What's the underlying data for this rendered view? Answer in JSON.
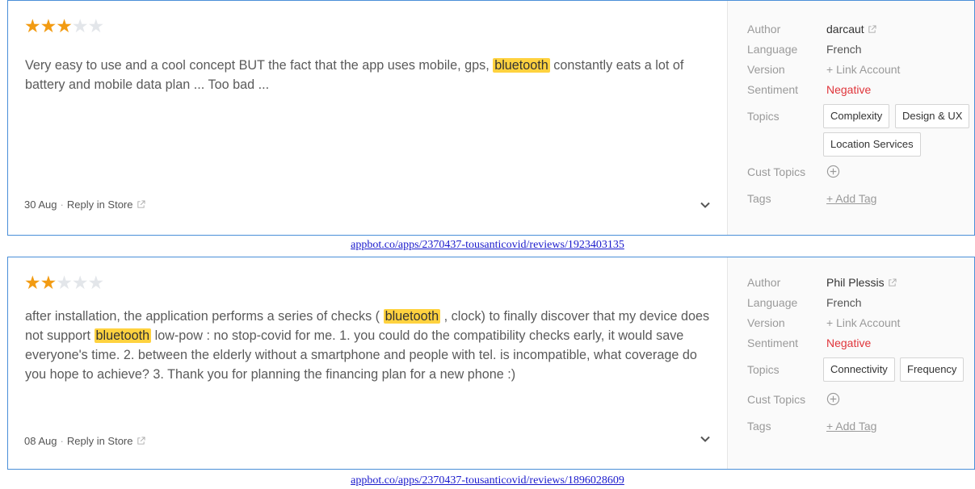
{
  "reviews": [
    {
      "rating": 3,
      "text_parts": [
        "Very easy to use and a cool concept BUT the fact that the app uses mobile, gps, ",
        "bluetooth",
        " constantly eats a lot of battery and mobile data plan ... Too bad ..."
      ],
      "date": "30 Aug",
      "separator": "·",
      "reply_label": "Reply in Store",
      "labels": {
        "author": "Author",
        "language": "Language",
        "version": "Version",
        "sentiment": "Sentiment",
        "topics": "Topics",
        "cust_topics": "Cust Topics",
        "tags": "Tags"
      },
      "author": "darcaut",
      "language": "French",
      "version": "+ Link Account",
      "sentiment": "Negative",
      "topics": [
        "Complexity",
        "Design & UX",
        "Location Services"
      ],
      "add_tag": "+ Add Tag",
      "caption": "appbot.co/apps/2370437-tousanticovid/reviews/1923403135"
    },
    {
      "rating": 2,
      "text_parts": [
        "after installation, the application performs a series of checks ( ",
        "bluetooth",
        " , clock) to finally discover that my device does not support ",
        "bluetooth",
        " low-pow : no stop-covid for me. 1. you could do the compatibility checks early, it would save everyone's time. 2. between the elderly without a smartphone and people with tel. is incompatible, what coverage do you hope to achieve? 3. Thank you for planning the financing plan for a new phone :)"
      ],
      "date": "08 Aug",
      "separator": "·",
      "reply_label": "Reply in Store",
      "labels": {
        "author": "Author",
        "language": "Language",
        "version": "Version",
        "sentiment": "Sentiment",
        "topics": "Topics",
        "cust_topics": "Cust Topics",
        "tags": "Tags"
      },
      "author": "Phil Plessis",
      "language": "French",
      "version": "+ Link Account",
      "sentiment": "Negative",
      "topics": [
        "Connectivity",
        "Frequency"
      ],
      "add_tag": "+ Add Tag",
      "caption": "appbot.co/apps/2370437-tousanticovid/reviews/1896028609"
    }
  ],
  "colors": {
    "star_on": "#f29b12",
    "star_off": "#e3e6ea",
    "highlight": "#ffd23f",
    "negative": "#e0353b",
    "border": "#4a8fd8",
    "caption_link": "#1a1acc"
  },
  "icons": {
    "star": "star-icon",
    "external": "external-link-icon",
    "chevron": "chevron-down-icon",
    "add": "plus-circle-icon"
  }
}
